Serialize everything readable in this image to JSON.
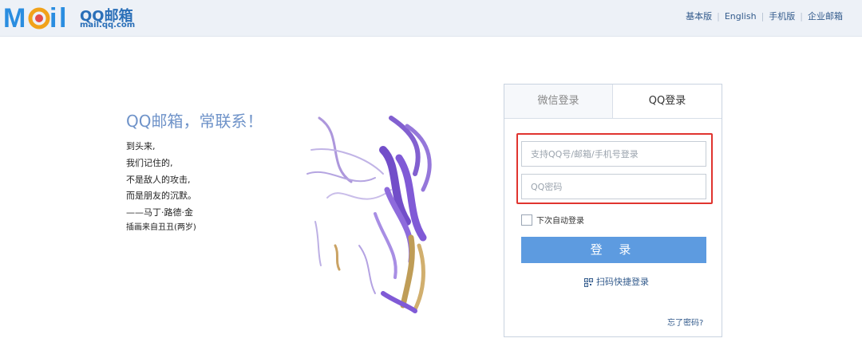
{
  "header": {
    "logo_text": "MOil",
    "brand_cn": "QQ邮箱",
    "brand_url": "mail.qq.com",
    "links": [
      "基本版",
      "English",
      "手机版",
      "企业邮箱"
    ]
  },
  "promo": {
    "slogan": "QQ邮箱，常联系！",
    "poem": [
      "到头来,",
      "我们记住的,",
      "不是敌人的攻击,",
      "而是朋友的沉默。",
      "——马丁·路德·金"
    ],
    "credit": "插画来自丑丑(两岁)"
  },
  "login": {
    "tabs": [
      "微信登录",
      "QQ登录"
    ],
    "active_tab": "QQ登录",
    "username_placeholder": "支持QQ号/邮箱/手机号登录",
    "password_placeholder": "QQ密码",
    "auto_login": "下次自动登录",
    "auto_login_checked": false,
    "submit": "登 录",
    "qr_login": "扫码快捷登录",
    "forgot": "忘了密码?"
  },
  "colors": {
    "header_bg": "#edf1f7",
    "brand": "#2a6fb8",
    "button": "#5d9be0",
    "highlight": "#e0342f",
    "slogan": "#6f93c9"
  },
  "icons": [
    "mail-logo-icon",
    "qr-code-icon",
    "watercolor-illustration"
  ]
}
